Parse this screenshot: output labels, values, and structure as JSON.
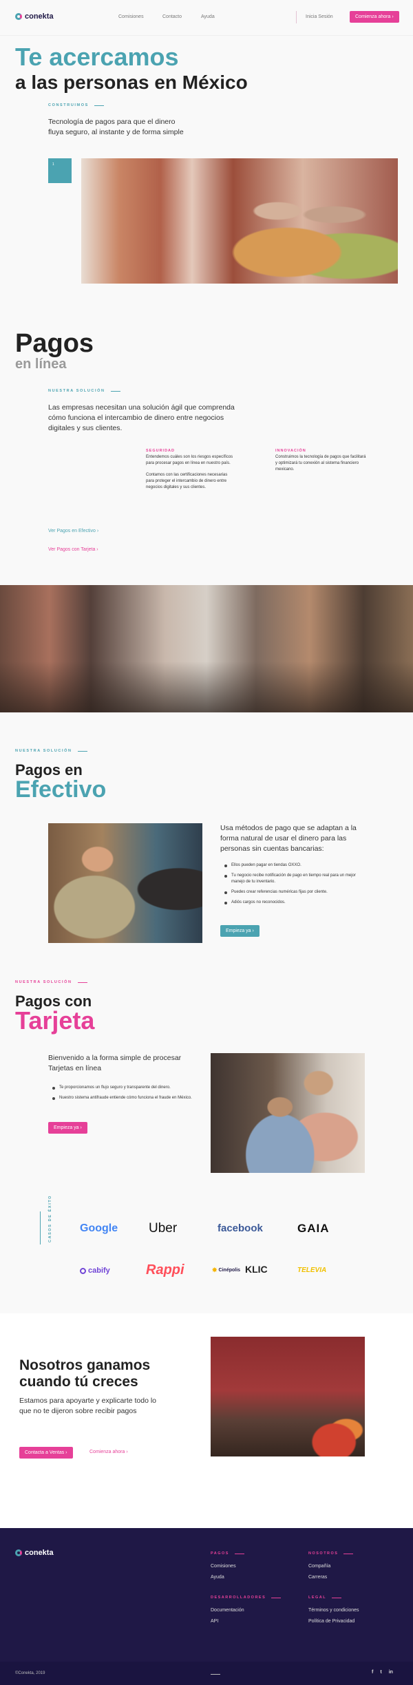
{
  "header": {
    "logo_text": "conekta",
    "nav": [
      "Comisiones",
      "Contacto",
      "Ayuda"
    ],
    "login": "Inicia Sesión",
    "cta": "Comienza ahora"
  },
  "hero": {
    "title_line1": "Te acercamos",
    "title_line2": "a las personas en México",
    "eyebrow": "CONSTRUIMOS",
    "text": "Tecnología de pagos para que el dinero fluya seguro, al instante y de forma simple",
    "counter": "1"
  },
  "pagos_linea": {
    "title": "Pagos",
    "subtitle": "en línea",
    "eyebrow": "NUESTRA SOLUCIÓN",
    "text": "Las empresas necesitan una solución ágil que comprenda cómo funciona el intercambio de dinero entre negocios digitales y sus clientes.",
    "seguridad_title": "SEGURIDAD",
    "seguridad_p1": "Entendemos cuáles son los riesgos específicos para procesar pagos en línea en nuestro país.",
    "seguridad_p2": "Contamos con las certificaciones necesarias para proteger el intercambio de dinero entre negocios digitales y sus clientes.",
    "innovacion_title": "INNOVACIÓN",
    "innovacion_p": "Construimos la tecnología de pagos que facilitará y optimizará tu conexión al sistema financiero mexicano.",
    "link_efectivo": "Ver Pagos en Efectivo",
    "link_tarjeta": "Ver Pagos con Tarjeta"
  },
  "efectivo": {
    "eyebrow": "NUESTRA SOLUCIÓN",
    "title_line1": "Pagos en",
    "title_line2": "Efectivo",
    "text": "Usa métodos de pago que se adaptan a la forma natural de usar el dinero para las personas sin cuentas bancarias:",
    "bullets": [
      "Ellos pueden pagar en tiendas OXXO.",
      "Tu negocio recibe notificación de pago en tiempo real para un mejor manejo de tu inventario.",
      "Puedes crear referencias numéricas fijas por cliente.",
      "Adiós cargos no reconocidos."
    ],
    "cta": "Empieza ya"
  },
  "tarjeta": {
    "eyebrow": "NUESTRA SOLUCIÓN",
    "title_line1": "Pagos con",
    "title_line2": "Tarjeta",
    "text": "Bienvenido a la forma simple de procesar Tarjetas en línea",
    "bullets": [
      "Te proporcionamos un flujo seguro y transparente del dinero.",
      "Nuestro sistema antifraude entiende cómo funciona el fraude en México."
    ],
    "cta": "Empieza ya"
  },
  "clients": {
    "label": "CASOS DE ÉXITO",
    "logos": [
      "Google",
      "Uber",
      "facebook",
      "GAIA",
      "cabify",
      "Rappi",
      "Cinépolis",
      "KLIC",
      "TELEVIA"
    ]
  },
  "grow": {
    "title_line1": "Nosotros ganamos",
    "title_line2": "cuando tú creces",
    "text": "Estamos para apoyarte y explicarte todo lo que no te dijeron sobre recibir pagos",
    "cta_sales": "Contacta a Ventas",
    "cta_start": "Comienza ahora"
  },
  "footer": {
    "logo_text": "conekta",
    "pagos_title": "PAGOS",
    "pagos_links": [
      "Comisiones",
      "Ayuda"
    ],
    "nosotros_title": "NOSOTROS",
    "nosotros_links": [
      "Compañía",
      "Carreras"
    ],
    "dev_title": "DESARROLLADORES",
    "dev_links": [
      "Documentación",
      "API"
    ],
    "legal_title": "LEGAL",
    "legal_links": [
      "Términos y condiciones",
      "Política de Privacidad"
    ],
    "copyright": "©Conekta, 2019"
  },
  "colors": {
    "teal": "#4ba3b1",
    "pink": "#e64098",
    "navy": "#1f1846"
  }
}
